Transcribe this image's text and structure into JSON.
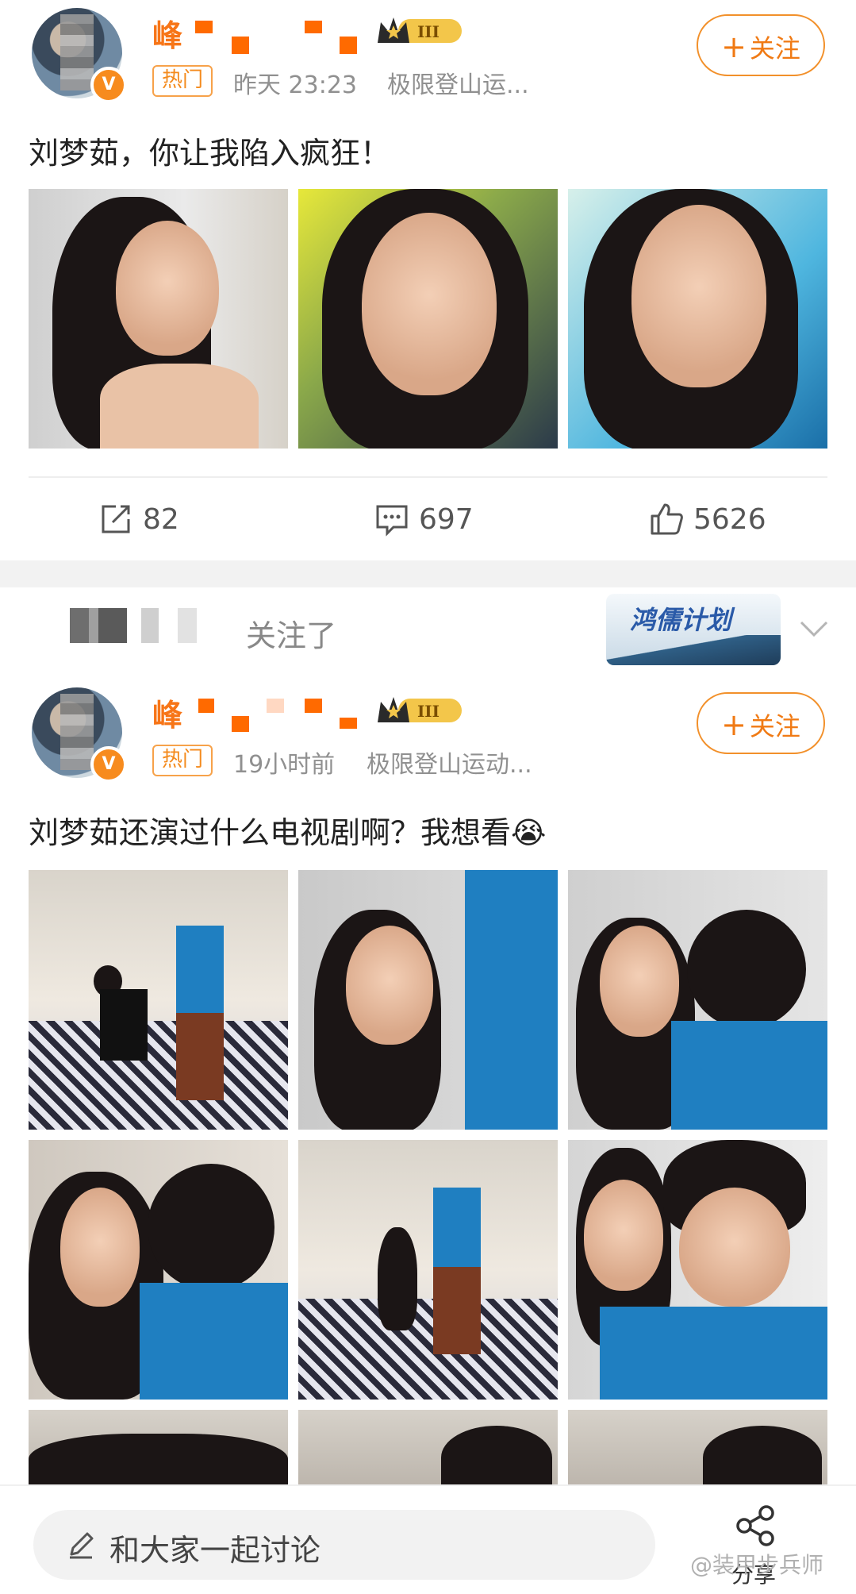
{
  "post1": {
    "username": "峰",
    "hot_tag": "热门",
    "time": "昨天 23:23",
    "source": "极限登山运...",
    "follow_label": "关注",
    "content": "刘梦茹，你让我陷入疯狂！",
    "actions": {
      "repost": "82",
      "comment": "697",
      "like": "5626"
    }
  },
  "feed_notice": {
    "text": "关注了",
    "banner_title": "鸿儒计划"
  },
  "post2": {
    "username": "峰",
    "hot_tag": "热门",
    "time": "19小时前",
    "source": "极限登山运动...",
    "follow_label": "关注",
    "content": "刘梦茹还演过什么电视剧啊？我想看😭"
  },
  "bottom_bar": {
    "input_placeholder": "和大家一起讨论",
    "share_label": "分享"
  },
  "watermark": "@装甲步兵师",
  "colors": {
    "accent": "#f77517",
    "tag_border": "#f7a24a",
    "divider": "#eeeeee"
  },
  "icons": [
    "repost-icon",
    "comment-icon",
    "like-icon",
    "edit-icon",
    "share-icon",
    "chevron-down-icon",
    "verified-icon",
    "crown-badge-icon"
  ]
}
